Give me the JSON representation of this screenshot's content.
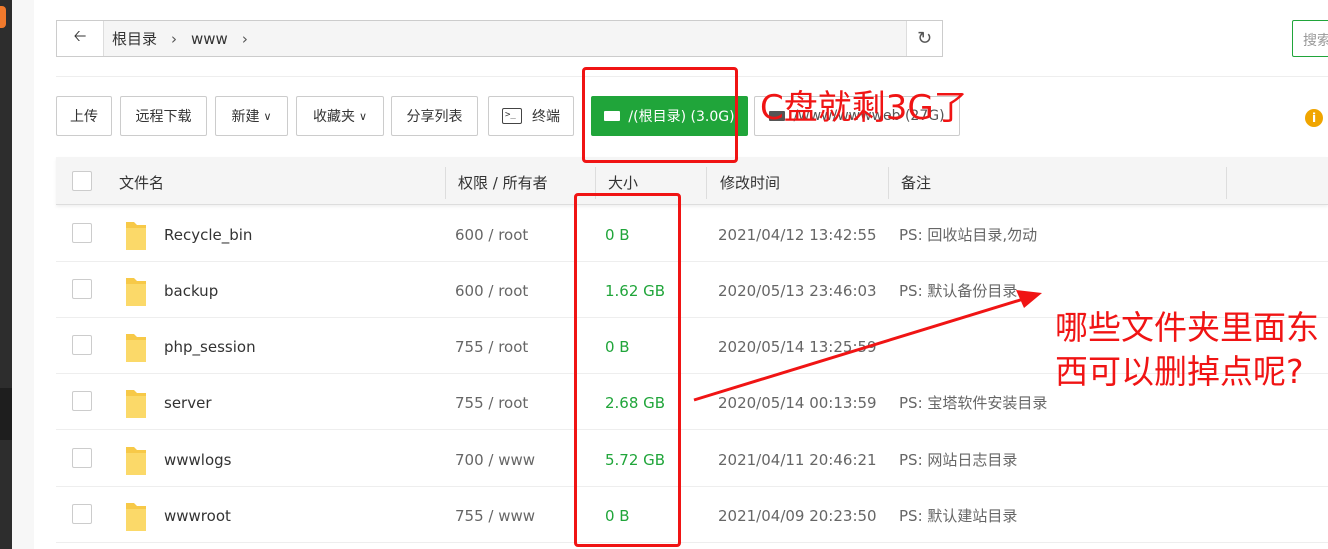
{
  "pathbar": {
    "crumbs": [
      "根目录",
      "www"
    ],
    "search_placeholder": "搜索"
  },
  "toolbar": {
    "upload": "上传",
    "remote_download": "远程下载",
    "new": "新建",
    "favorites": "收藏夹",
    "share_list": "分享列表",
    "terminal": "终端",
    "disk_root": "/(根目录) (3.0G)",
    "disk_www": "/www/wwwweb (27G)"
  },
  "table": {
    "headers": {
      "name": "文件名",
      "perm": "权限 / 所有者",
      "size": "大小",
      "mtime": "修改时间",
      "note": "备注"
    },
    "rows": [
      {
        "name": "Recycle_bin",
        "perm": "600 / root",
        "size": "0 B",
        "mtime": "2021/04/12 13:42:55",
        "note": "PS: 回收站目录,勿动"
      },
      {
        "name": "backup",
        "perm": "600 / root",
        "size": "1.62 GB",
        "mtime": "2020/05/13 23:46:03",
        "note": "PS: 默认备份目录"
      },
      {
        "name": "php_session",
        "perm": "755 / root",
        "size": "0 B",
        "mtime": "2020/05/14 13:25:59",
        "note": ""
      },
      {
        "name": "server",
        "perm": "755 / root",
        "size": "2.68 GB",
        "mtime": "2020/05/14 00:13:59",
        "note": "PS: 宝塔软件安装目录"
      },
      {
        "name": "wwwlogs",
        "perm": "700 / www",
        "size": "5.72 GB",
        "mtime": "2021/04/11 20:46:21",
        "note": "PS: 网站日志目录"
      },
      {
        "name": "wwwroot",
        "perm": "755 / www",
        "size": "0 B",
        "mtime": "2021/04/09 20:23:50",
        "note": "PS: 默认建站目录"
      }
    ]
  },
  "annotations": {
    "top": "C盘就剩3G了",
    "question_line1": "哪些文件夹里面东",
    "question_line2": "西可以删掉点呢?"
  },
  "colors": {
    "accent_green": "#20a53a",
    "annotation_red": "#f01414",
    "folder_yellow": "#f7c948"
  }
}
